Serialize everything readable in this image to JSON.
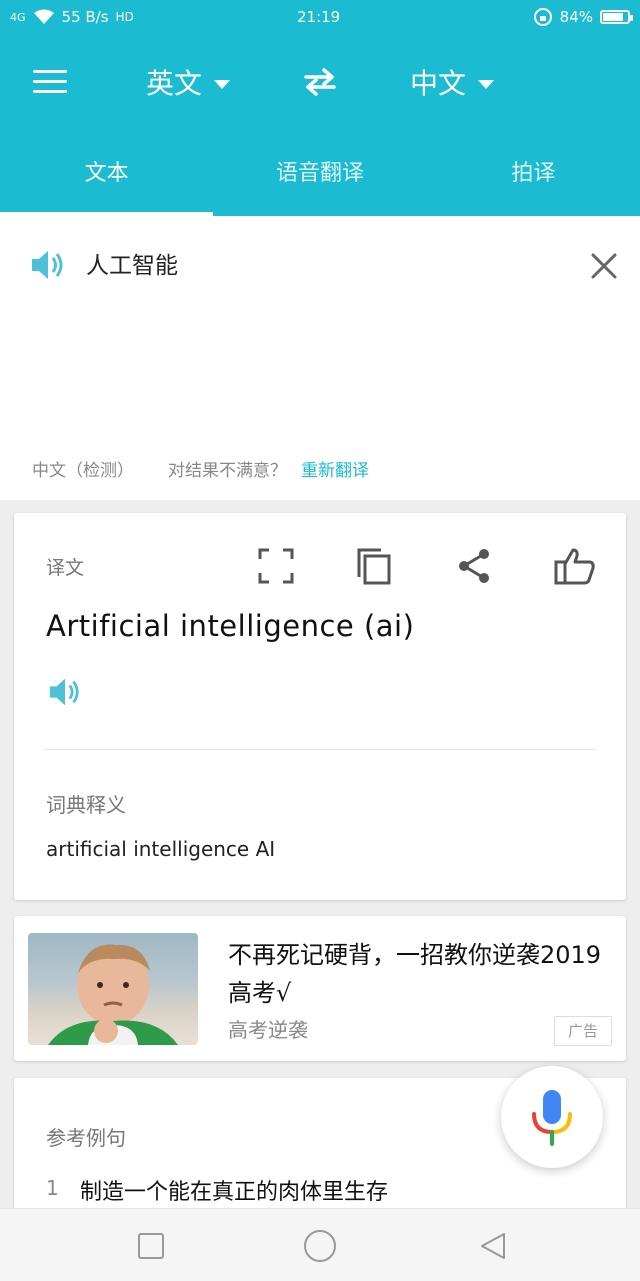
{
  "status_bar": {
    "network": "4G",
    "speed": "55 B/s",
    "hd": "HD",
    "time": "21:19",
    "battery": "84%",
    "battery_level": 0.84
  },
  "toolbar": {
    "source_lang": "英文",
    "target_lang": "中文"
  },
  "tabs": [
    {
      "label": "文本",
      "active": true
    },
    {
      "label": "语音翻译",
      "active": false
    },
    {
      "label": "拍译",
      "active": false
    }
  ],
  "input": {
    "text": "人工智能",
    "detected": "中文（检测）",
    "unsatisfied": "对结果不满意？",
    "retranslate": "重新翻译"
  },
  "translation_card": {
    "label": "译文",
    "result": "Artificial intelligence (ai)",
    "dict_label": "词典释义",
    "dict_text": "artificial intelligence AI"
  },
  "ad_card": {
    "title": "不再死记硬背，一招教你逆袭2019高考√",
    "source": "高考逆袭",
    "badge": "广告"
  },
  "examples_card": {
    "label": "参考例句",
    "items": [
      {
        "num": "1",
        "text": "制造一个能在真正的肉体里生存"
      }
    ]
  },
  "colors": {
    "accent": "#1bbcd1",
    "mic_blue": "#4285f4",
    "mic_red": "#ea4335",
    "mic_yellow": "#fbbc05",
    "mic_green": "#34a853"
  }
}
